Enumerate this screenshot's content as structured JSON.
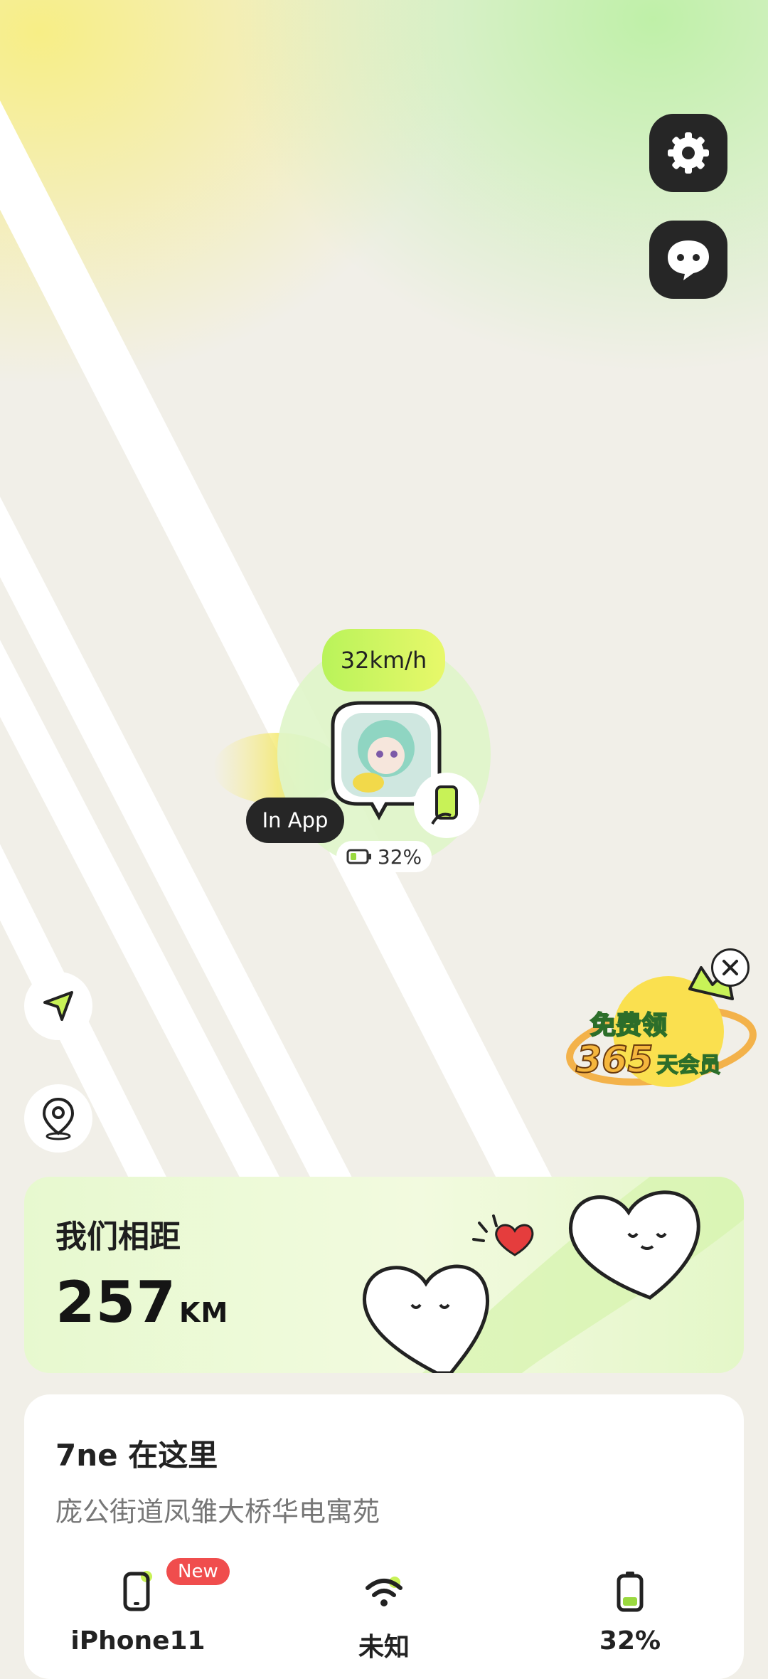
{
  "map": {
    "speed": "32km/h",
    "status": "In App",
    "battery": "32%"
  },
  "top_buttons": {
    "settings_icon": "gear-icon",
    "chat_icon": "chat-bubble-icon"
  },
  "side_buttons": {
    "locate_icon": "navigation-arrow-icon",
    "pin_icon": "location-pin-icon"
  },
  "promo": {
    "line1": "免费领",
    "line2_number": "365",
    "line2_text": "天会员"
  },
  "distance": {
    "title": "我们相距",
    "value": "257",
    "unit": "KM"
  },
  "location": {
    "title": "7ne 在这里",
    "address": "庞公街道凤雏大桥华电寓苑"
  },
  "stats": {
    "device": "iPhone11",
    "device_badge": "New",
    "network": "未知",
    "battery": "32%"
  },
  "colors": {
    "accent_green": "#b9f35a",
    "dark": "#262626",
    "badge_red": "#f04d4d"
  }
}
